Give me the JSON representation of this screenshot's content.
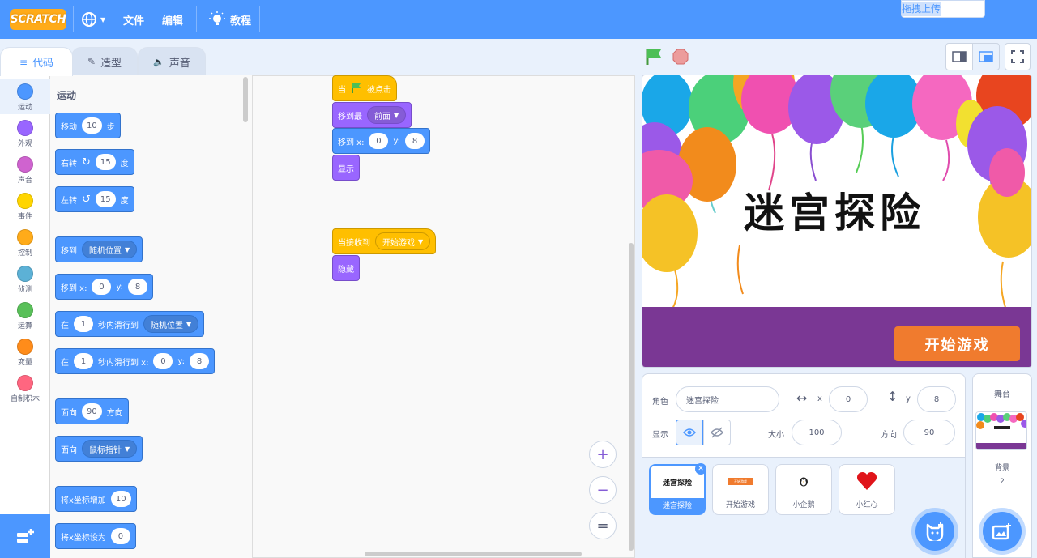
{
  "menubar": {
    "logo": "SCRATCH",
    "file": "文件",
    "edit": "编辑",
    "tutorials": "教程",
    "upload": "拖拽上传"
  },
  "tabs": [
    {
      "label": "代码",
      "icon": "code-icon"
    },
    {
      "label": "造型",
      "icon": "brush-icon"
    },
    {
      "label": "声音",
      "icon": "speaker-icon"
    }
  ],
  "categories": [
    {
      "label": "运动",
      "color": "#4c97ff"
    },
    {
      "label": "外观",
      "color": "#9966ff"
    },
    {
      "label": "声音",
      "color": "#cf63cf"
    },
    {
      "label": "事件",
      "color": "#ffd500"
    },
    {
      "label": "控制",
      "color": "#ffab19"
    },
    {
      "label": "侦测",
      "color": "#5cb1d6"
    },
    {
      "label": "运算",
      "color": "#59c059"
    },
    {
      "label": "变量",
      "color": "#ff8c1a"
    },
    {
      "label": "自制积木",
      "color": "#ff6680"
    }
  ],
  "palette": {
    "title": "运动",
    "move": {
      "pre": "移动",
      "val": "10",
      "post": "步"
    },
    "turn_right": {
      "pre": "右转",
      "val": "15",
      "post": "度"
    },
    "turn_left": {
      "pre": "左转",
      "val": "15",
      "post": "度"
    },
    "goto": {
      "pre": "移到",
      "drop": "随机位置"
    },
    "goto_xy": {
      "pre": "移到 x:",
      "x": "0",
      "ylabel": "y:",
      "y": "8"
    },
    "glide": {
      "pre": "在",
      "secs": "1",
      "mid": "秒内滑行到",
      "drop": "随机位置"
    },
    "glide_xy": {
      "pre": "在",
      "secs": "1",
      "mid": "秒内滑行到 x:",
      "x": "0",
      "ylabel": "y:",
      "y": "8"
    },
    "point_dir": {
      "pre": "面向",
      "val": "90",
      "post": "方向"
    },
    "point_towards": {
      "pre": "面向",
      "drop": "鼠标指针"
    },
    "change_x": {
      "pre": "将x坐标增加",
      "val": "10"
    },
    "set_x": {
      "pre": "将x坐标设为",
      "val": "0"
    }
  },
  "script1": {
    "hat": {
      "pre": "当",
      "post": "被点击"
    },
    "front": {
      "pre": "移到最",
      "drop": "前面"
    },
    "goto_xy": {
      "pre": "移到 x:",
      "x": "0",
      "ylabel": "y:",
      "y": "8"
    },
    "show": "显示"
  },
  "script2": {
    "hat": {
      "pre": "当接收到",
      "drop": "开始游戏"
    },
    "hide": "隐藏"
  },
  "zoom": {
    "in": "+",
    "out": "−",
    "reset": "="
  },
  "stage": {
    "title": "迷宫探险",
    "button": "开始游戏"
  },
  "sprite_info": {
    "sprite_label": "角色",
    "sprite_name": "迷宫探险",
    "x_label": "x",
    "x": "0",
    "y_label": "y",
    "y": "8",
    "show_label": "显示",
    "size_label": "大小",
    "size": "100",
    "dir_label": "方向",
    "dir": "90"
  },
  "sprites": [
    {
      "name": "迷宫探险",
      "thumb": "迷宫探险"
    },
    {
      "name": "开始游戏",
      "thumb": "开始游戏"
    },
    {
      "name": "小企鹅",
      "thumb": "penguin"
    },
    {
      "name": "小红心",
      "thumb": "heart"
    }
  ],
  "stage_pane": {
    "title": "舞台",
    "backdrops_label": "背景",
    "backdrops_count": "2"
  },
  "colors": {
    "accent": "#4c97ff",
    "motion": "#4c97ff",
    "looks": "#9966ff",
    "events": "#ffbf00",
    "stage_band": "#7a3794",
    "start_button": "#f07b2e"
  }
}
